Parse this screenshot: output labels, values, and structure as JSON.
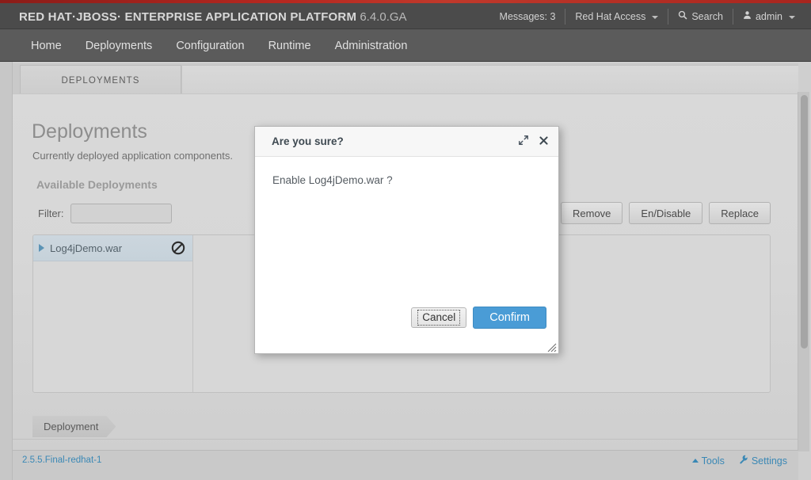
{
  "masthead": {
    "brand_bold": "RED HAT·JBOSS· ENTERPRISE APPLICATION PLATFORM",
    "brand_version": "6.4.0.GA",
    "messages": "Messages: 3",
    "red_hat_access": "Red Hat Access",
    "search": "Search",
    "user": "admin"
  },
  "nav": {
    "items": [
      {
        "label": "Home"
      },
      {
        "label": "Deployments"
      },
      {
        "label": "Configuration"
      },
      {
        "label": "Runtime"
      },
      {
        "label": "Administration"
      }
    ]
  },
  "tabs": {
    "active": "DEPLOYMENTS"
  },
  "main": {
    "title": "Deployments",
    "subtitle": "Currently deployed application components.",
    "section_heading": "Available Deployments",
    "filter_label": "Filter:",
    "filter_value": "",
    "filter_placeholder": "",
    "buttons": [
      {
        "label": "Remove",
        "name": "remove-button"
      },
      {
        "label": "En/Disable",
        "name": "endisable-button"
      },
      {
        "label": "Replace",
        "name": "replace-button"
      }
    ],
    "deployments": [
      {
        "name": "Log4jDemo.war",
        "status_icon": "disabled-circle-slash-icon",
        "selected": true
      }
    ],
    "breadcrumb": "Deployment"
  },
  "modal": {
    "title": "Are you sure?",
    "body": "Enable Log4jDemo.war ?",
    "maximize_icon": "expand-diagonal-icon",
    "close_icon": "close-x-icon",
    "cancel_label": "Cancel",
    "confirm_label": "Confirm",
    "resize_icon": "resize-grip-icon"
  },
  "footer": {
    "version": "2.5.5.Final-redhat-1",
    "tools": "Tools",
    "settings": "Settings"
  },
  "colors": {
    "accent_red": "#c0392b",
    "link_blue": "#3a88b5",
    "confirm_blue": "#4a9cd6",
    "masthead_bg": "#4b4b4b",
    "navbar_bg": "#5b5b5b"
  }
}
